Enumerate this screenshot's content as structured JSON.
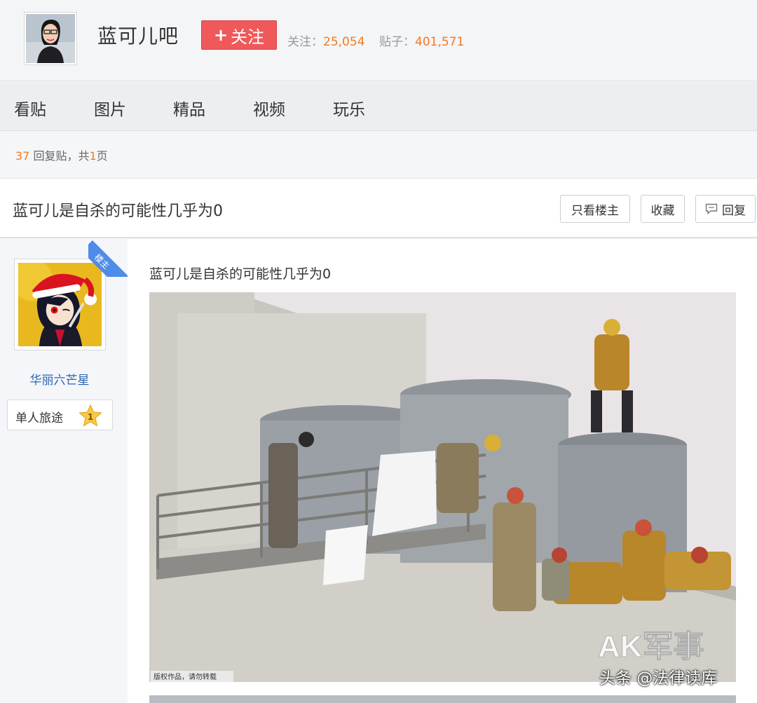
{
  "forum": {
    "name": "蓝可儿吧",
    "follow_label": "关注",
    "follow_prefix": "+",
    "follow_stat_label": "关注：",
    "follow_stat_value": "25,054",
    "posts_stat_label": "贴子：",
    "posts_stat_value": "401,571"
  },
  "nav": {
    "items": [
      "看贴",
      "图片",
      "精品",
      "视频",
      "玩乐"
    ]
  },
  "thread_meta": {
    "reply_count": "37",
    "reply_text": " 回复贴，共",
    "page_count": "1",
    "page_suffix": "页"
  },
  "thread": {
    "title": "蓝可儿是自杀的可能性几乎为0",
    "only_op_label": "只看楼主",
    "favorite_label": "收藏",
    "reply_label": "回复"
  },
  "post": {
    "op_badge": "楼主",
    "username": "华丽六芒星",
    "level_name": "单人旅途",
    "level_number": "1",
    "content": "蓝可儿是自杀的可能性几乎为0",
    "image_logo": "AK军事",
    "image_caption": "版权作品，请勿转载"
  },
  "watermark": "头条 @法律读库",
  "colors": {
    "accent_orange": "#f47920",
    "follow_red": "#f0595a",
    "link_blue": "#2d64b3",
    "badge_blue": "#4f8be8"
  }
}
